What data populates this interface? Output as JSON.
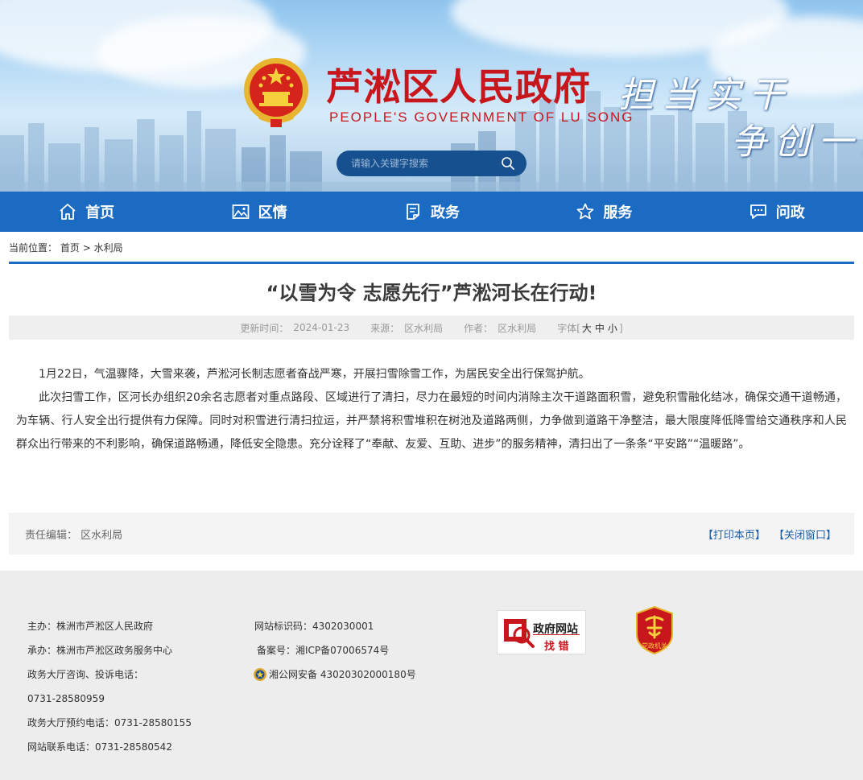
{
  "header": {
    "site_title": "芦淞区人民政府",
    "site_subtitle": "PEOPLE'S GOVERNMENT OF  LU SONG",
    "slogan_line1": "担当实干",
    "slogan_line2": "争创一流",
    "search_placeholder": "请输入关键字搜索"
  },
  "nav": {
    "items": [
      {
        "label": "首页",
        "icon": "home-icon"
      },
      {
        "label": "区情",
        "icon": "picture-icon"
      },
      {
        "label": "政务",
        "icon": "document-icon"
      },
      {
        "label": "服务",
        "icon": "star-icon"
      },
      {
        "label": "问政",
        "icon": "chat-icon"
      }
    ]
  },
  "breadcrumb": {
    "prefix": "当前位置：",
    "home": "首页",
    "separator": ">",
    "current": "水利局"
  },
  "article": {
    "title": "“以雪为令 志愿先行”芦淞河长在行动!",
    "meta": {
      "updated_label": "更新时间：",
      "updated_value": "2024-01-23",
      "source_label": "来源：",
      "source_value": "区水利局",
      "author_label": "作者：",
      "author_value": "区水利局",
      "font_label": "字体[",
      "font_large": "大",
      "font_medium": "中",
      "font_small": "小",
      "font_close": "]"
    },
    "paragraphs": [
      "1月22日，气温骤降，大雪来袭，芦淞河长制志愿者奋战严寒，开展扫雪除雪工作，为居民安全出行保驾护航。",
      "此次扫雪工作，区河长办组织20余名志愿者对重点路段、区域进行了清扫，尽力在最短的时间内消除主次干道路面积雪，避免积雪融化结冰，确保交通干道畅通，为车辆、行人安全出行提供有力保障。同时对积雪进行清扫拉运，并严禁将积雪堆积在树池及道路两侧，力争做到道路干净整洁，最大限度降低降雪给交通秩序和人民群众出行带来的不利影响，确保道路畅通，降低安全隐患。充分诠释了“奉献、友爱、互助、进步”的服务精神，清扫出了一条条“平安路”“温暖路”。"
    ]
  },
  "editor": {
    "label": "责任编辑：",
    "value": "区水利局",
    "print": "【打印本页】",
    "close": "【关闭窗口】"
  },
  "footer": {
    "host": "主办：株洲市芦淞区人民政府",
    "organizer": "承办：株洲市芦淞区政务服务中心",
    "hall_label": "政务大厅咨询、投诉电话：",
    "hall_phone": "0731-28580959",
    "booking": "政务大厅预约电话：0731-28580155",
    "site_phone": "网站联系电话：0731-28580542",
    "site_id": "网站标识码：4302030001",
    "icp": "备案号：湘ICP备07006574号",
    "police": "湘公网安备 43020302000180号",
    "badge_zf_line1": "政府网站",
    "badge_zf_line2": "找 错",
    "badge_dz_text": "党政机关"
  },
  "colors": {
    "brand_blue": "#1a6bc1",
    "title_red": "#c8161d",
    "footer_bg": "#ededed"
  }
}
